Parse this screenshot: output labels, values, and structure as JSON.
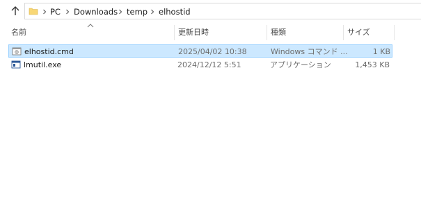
{
  "breadcrumb": {
    "items": [
      "PC",
      "Downloads",
      "temp",
      "elhostid"
    ]
  },
  "columns": {
    "name": "名前",
    "modified": "更新日時",
    "type": "種類",
    "size": "サイズ"
  },
  "files": [
    {
      "name": "elhostid.cmd",
      "modified": "2025/04/02 10:38",
      "type": "Windows コマンド ...",
      "size": "1 KB",
      "icon": "cmd-script-icon"
    },
    {
      "name": "lmutil.exe",
      "modified": "2024/12/12 5:51",
      "type": "アプリケーション",
      "size": "1,453 KB",
      "icon": "exe-application-icon"
    }
  ],
  "colors": {
    "selection_bg": "#cce8ff",
    "selection_border": "#99d1ff",
    "folder": "#f8d775"
  }
}
